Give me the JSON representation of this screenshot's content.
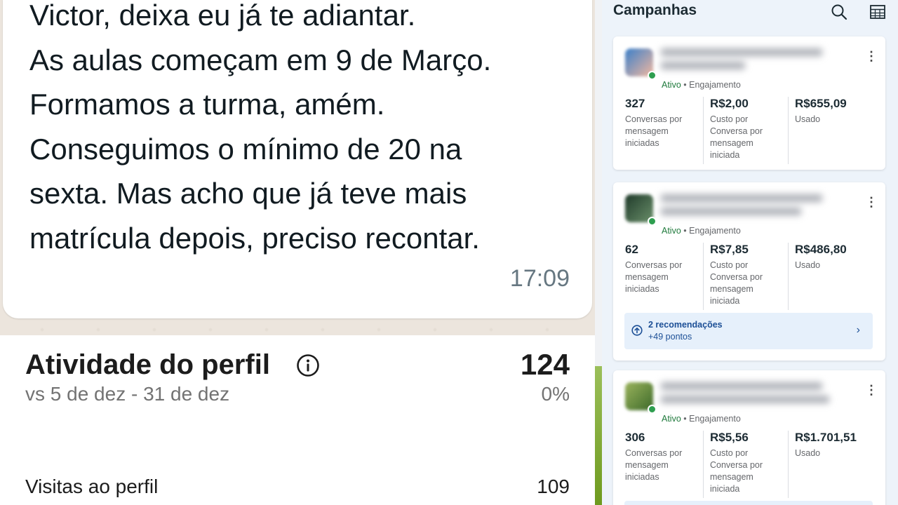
{
  "chat": {
    "message_lines": [
      "Victor, deixa eu já te adiantar.",
      "As aulas começam em 9 de Março.",
      "Formamos a turma, amém.",
      "Conseguimos o mínimo de 20 na",
      "sexta. Mas acho que já teve mais",
      "matrícula depois, preciso recontar."
    ],
    "time": "17:09"
  },
  "activity": {
    "title": "Atividade do perfil",
    "total": "124",
    "range": "vs 5 de dez - 31 de dez",
    "change": "0%",
    "visits_label": "Visitas ao perfil",
    "visits_value": "109"
  },
  "campaigns": {
    "title": "Campanhas",
    "icons": {
      "search": "search-icon",
      "table": "table-icon"
    },
    "cards": [
      {
        "status": "Ativo",
        "objective": "Engajamento",
        "metrics": [
          {
            "value": "327",
            "label": "Conversas por\nmensagem\niniciadas"
          },
          {
            "value": "R$2,00",
            "label": "Custo por\nConversa por\nmensagem\niniciada"
          },
          {
            "value": "R$655,09",
            "label": "Usado"
          }
        ]
      },
      {
        "status": "Ativo",
        "objective": "Engajamento",
        "metrics": [
          {
            "value": "62",
            "label": "Conversas por\nmensagem\niniciadas"
          },
          {
            "value": "R$7,85",
            "label": "Custo por\nConversa por\nmensagem\niniciada"
          },
          {
            "value": "R$486,80",
            "label": "Usado"
          }
        ],
        "recommendation": {
          "title": "2 recomendações",
          "points": "+49 pontos"
        }
      },
      {
        "status": "Ativo",
        "objective": "Engajamento",
        "metrics": [
          {
            "value": "306",
            "label": "Conversas por\nmensagem\niniciadas"
          },
          {
            "value": "R$5,56",
            "label": "Custo por\nConversa por\nmensagem\niniciada"
          },
          {
            "value": "R$1.701,51",
            "label": "Usado"
          }
        ]
      }
    ]
  },
  "colors": {
    "chat_bg": "#ece5dd",
    "panel_bg": "#edf3fa",
    "active_green": "#1f7a3c",
    "reco_blue": "#1c4f96"
  }
}
